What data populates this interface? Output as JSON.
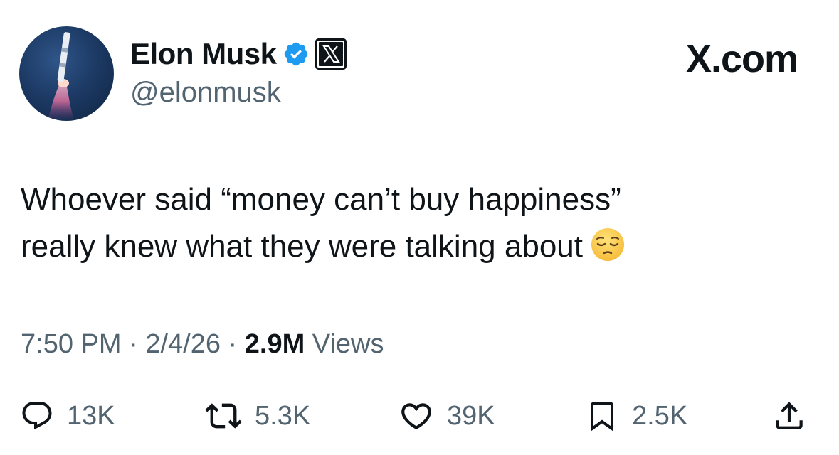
{
  "author": {
    "display_name": "Elon Musk",
    "handle": "@elonmusk",
    "verified_icon": "verified-badge-icon",
    "affiliation_icon": "x-logo-badge-icon",
    "avatar": "rocket-launch-avatar"
  },
  "brand": "X.com",
  "tweet": {
    "line1": "Whoever said “money can’t buy happiness”",
    "line2": "really knew what they were talking about",
    "emoji": "pensive-face-emoji"
  },
  "meta": {
    "time": "7:50 PM",
    "separator1": " · ",
    "date": "2/4/26",
    "separator2": " · ",
    "views_count": "2.9M",
    "views_label": " Views"
  },
  "actions": {
    "replies": {
      "icon": "reply-icon",
      "count": "13K"
    },
    "reposts": {
      "icon": "repost-icon",
      "count": "5.3K"
    },
    "likes": {
      "icon": "heart-icon",
      "count": "39K"
    },
    "bookmarks": {
      "icon": "bookmark-icon",
      "count": "2.5K"
    },
    "share": {
      "icon": "share-icon"
    }
  },
  "colors": {
    "text_primary": "#0f1419",
    "text_secondary": "#536471",
    "verified_blue": "#1d9bf0"
  }
}
